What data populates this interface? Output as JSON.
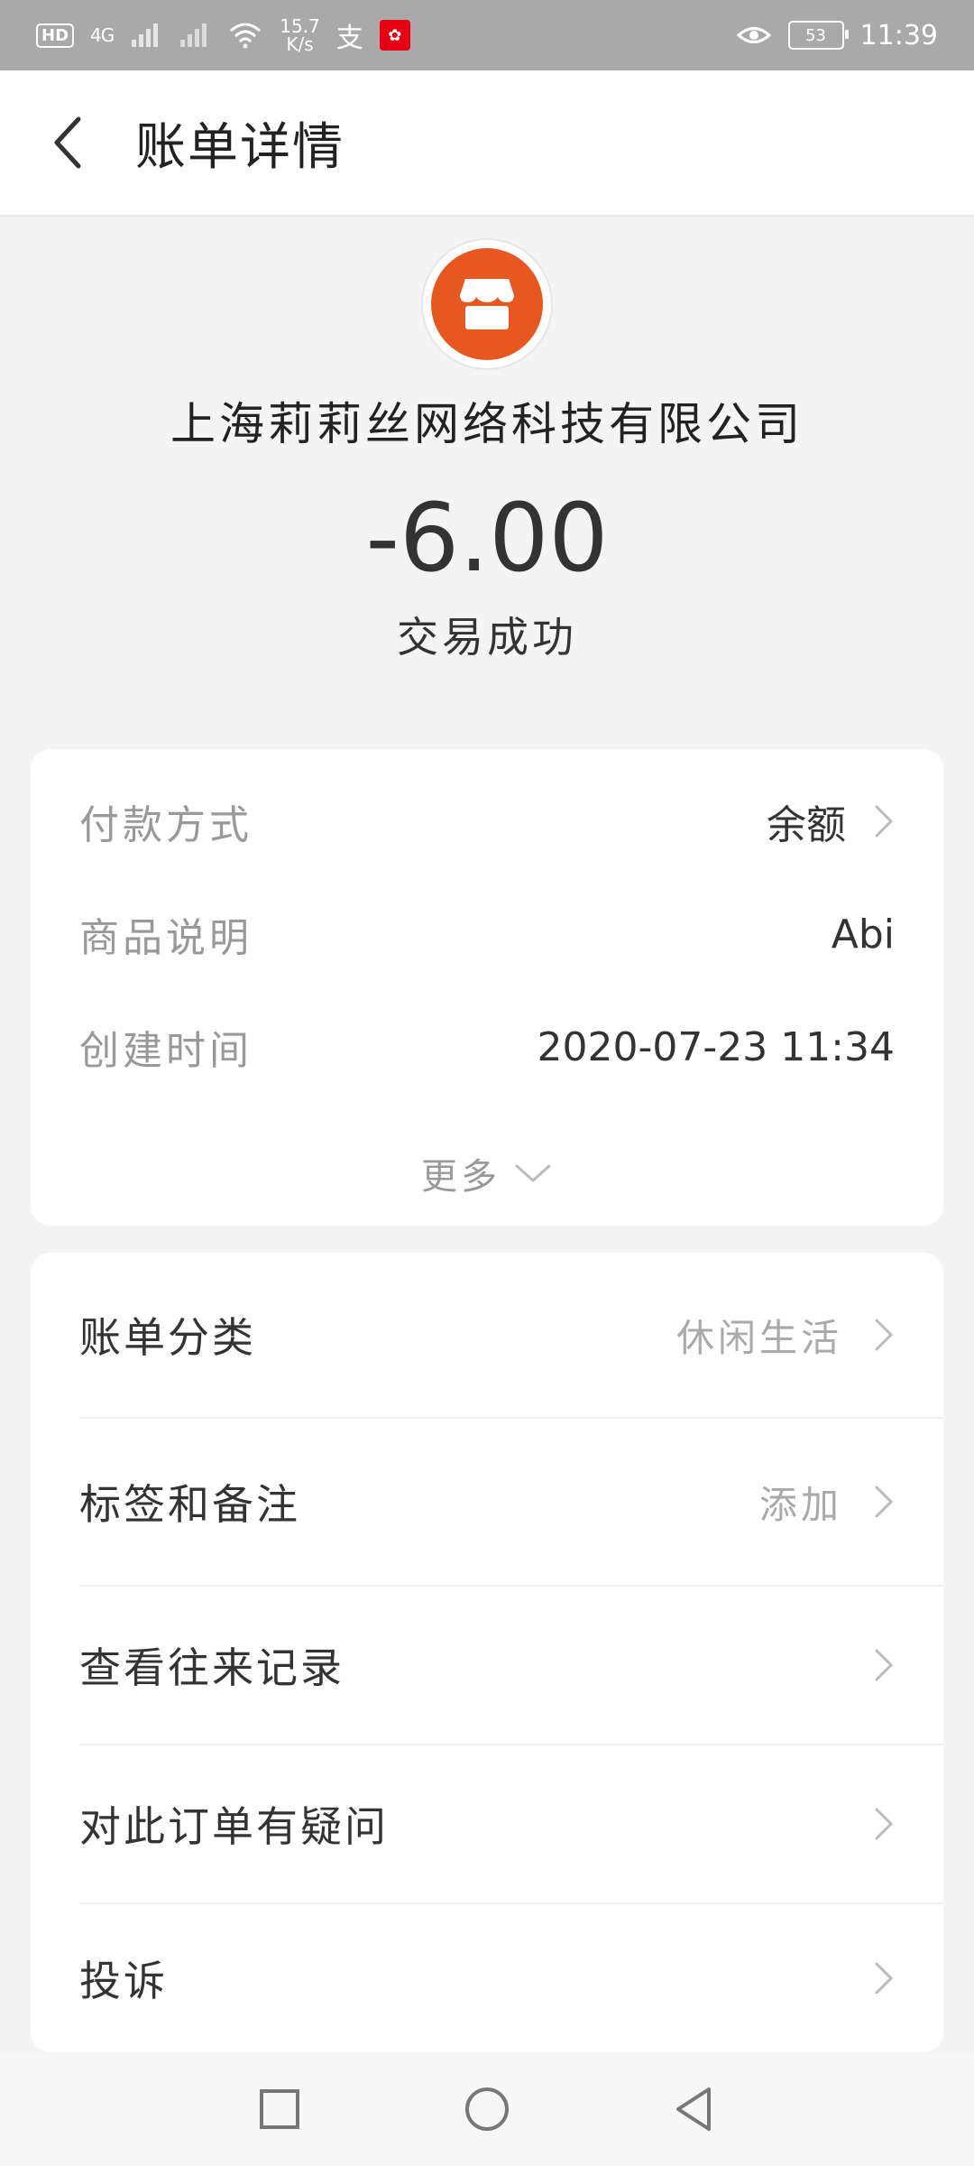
{
  "status_bar": {
    "hd": "HD",
    "network": "4G",
    "speed_value": "15.7",
    "speed_unit": "K/s",
    "battery": "53",
    "time": "11:39",
    "icons": [
      "hd-icon",
      "signal-icon",
      "wifi-icon",
      "alipay-icon",
      "app-icon",
      "eye-icon",
      "battery-icon"
    ]
  },
  "header": {
    "title": "账单详情",
    "back_icon": "chevron-left-icon"
  },
  "summary": {
    "logo_icon": "store-icon",
    "merchant": "上海莉莉丝网络科技有限公司",
    "amount": "-6.00",
    "status": "交易成功"
  },
  "details": {
    "rows": [
      {
        "label": "付款方式",
        "value": "余额",
        "has_arrow": true
      },
      {
        "label": "商品说明",
        "value": "Abi",
        "has_arrow": false
      },
      {
        "label": "创建时间",
        "value": "2020-07-23 11:34",
        "has_arrow": false
      }
    ],
    "more_label": "更多"
  },
  "menu": {
    "items": [
      {
        "label": "账单分类",
        "value": "休闲生活"
      },
      {
        "label": "标签和备注",
        "value": "添加"
      },
      {
        "label": "查看往来记录",
        "value": ""
      },
      {
        "label": "对此订单有疑问",
        "value": ""
      },
      {
        "label": "投诉",
        "value": ""
      }
    ]
  },
  "colors": {
    "accent": "#e8571f",
    "status_bar": "#a9a9a9",
    "background": "#f4f4f4"
  }
}
